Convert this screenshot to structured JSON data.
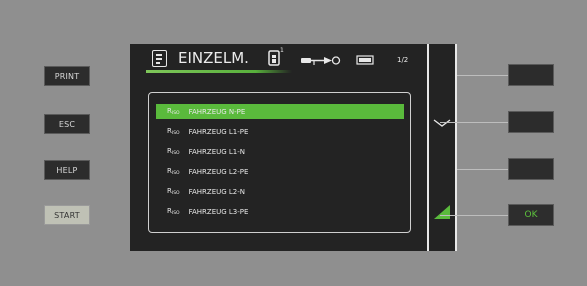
{
  "left_buttons": {
    "print": "PRINT",
    "esc": "ESC",
    "help": "HELP",
    "start": "START"
  },
  "header": {
    "title": "EINZELM.",
    "probe_superscript": "1",
    "page_indicator": "1/2"
  },
  "list": {
    "items": [
      {
        "prefix": "R",
        "sub": "ISO",
        "label": "FAHRZEUG N-PE",
        "selected": true
      },
      {
        "prefix": "R",
        "sub": "ISO",
        "label": "FAHRZEUG L1-PE",
        "selected": false
      },
      {
        "prefix": "R",
        "sub": "ISO",
        "label": "FAHRZEUG L1-N",
        "selected": false
      },
      {
        "prefix": "R",
        "sub": "ISO",
        "label": "FAHRZEUG L2-PE",
        "selected": false
      },
      {
        "prefix": "R",
        "sub": "ISO",
        "label": "FAHRZEUG L2-N",
        "selected": false
      },
      {
        "prefix": "R",
        "sub": "ISO",
        "label": "FAHRZEUG L3-PE",
        "selected": false
      }
    ]
  },
  "softkeys": {
    "key1": "",
    "key2": "",
    "key3": "",
    "ok": "OK"
  },
  "icons": {
    "doc": "document-list-icon",
    "probe": "probe-device-icon",
    "plug": "plug-connector-icon",
    "battery": "battery-icon",
    "scroll_down": "chevron-down-icon",
    "next": "green-triangle-icon"
  },
  "colors": {
    "accent": "#5aba3c",
    "screen": "#232323",
    "device": "#8f8f8f"
  }
}
